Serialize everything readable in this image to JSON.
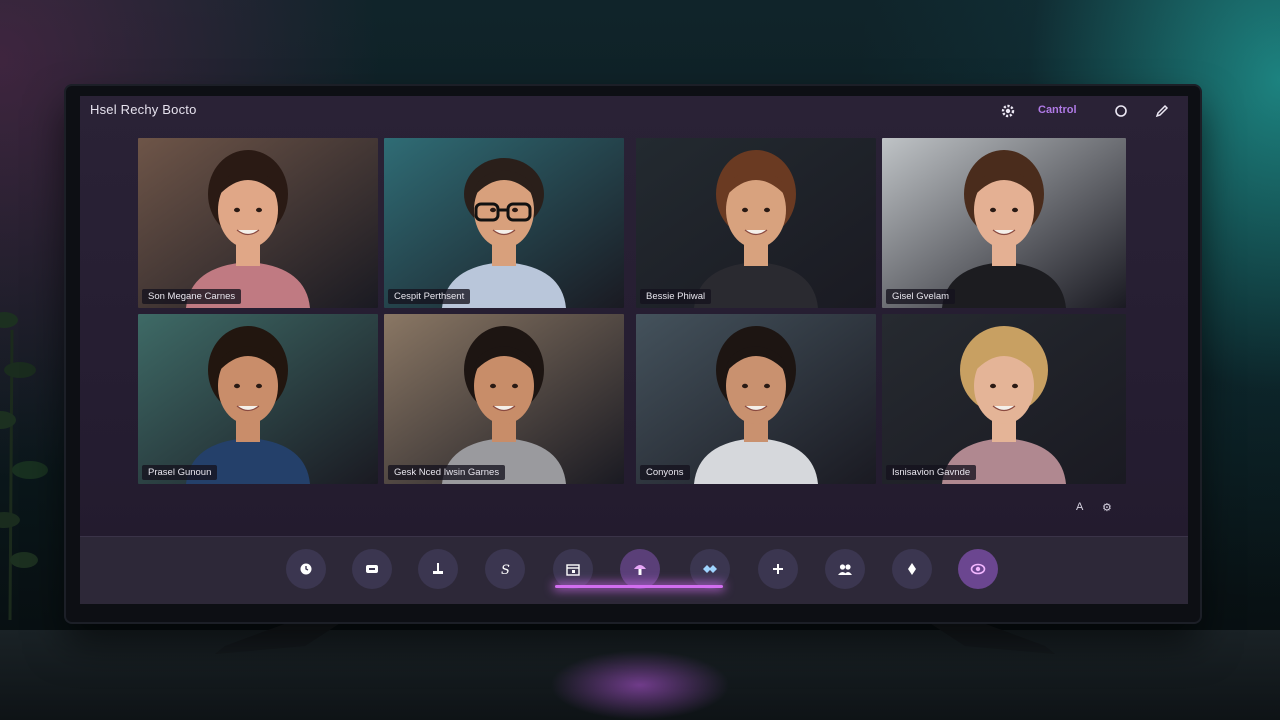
{
  "window": {
    "title": "Hsel Rechy Bocto"
  },
  "header": {
    "control_label": "Cantrol",
    "icons": [
      "settings-icon",
      "circle-icon",
      "pencil-icon"
    ]
  },
  "participants": [
    {
      "name": "Son Megane Carnes",
      "bg": "#6e5548",
      "skin": "#e0a787",
      "hair": "#2a1a14",
      "shirt": "#c07a82"
    },
    {
      "name": "Cespit Perthsent",
      "bg": "#2f6c75",
      "skin": "#d8a07c",
      "hair": "#2a1f1a",
      "shirt": "#b9c6da",
      "glasses": true
    },
    {
      "name": "Bessie Phiwal",
      "bg": "#232a30",
      "skin": "#d8a27e",
      "hair": "#6a3a22",
      "shirt": "#2a2a30"
    },
    {
      "name": "Gisel Gvelam",
      "bg": "#bfc3c6",
      "skin": "#e4b093",
      "hair": "#4a2c1c",
      "shirt": "#1c1c20"
    },
    {
      "name": "Prasel Gunoun",
      "bg": "#3e6a66",
      "skin": "#c98d6a",
      "hair": "#22160f",
      "shirt": "#24406a"
    },
    {
      "name": "Gesk Nced Iwsin Garnes",
      "bg": "#8a7764",
      "skin": "#c88d69",
      "hair": "#1d1512",
      "shirt": "#9a9a9e"
    },
    {
      "name": "Conyons",
      "bg": "#44525c",
      "skin": "#c9916f",
      "hair": "#1d1512",
      "shirt": "#d6d8dc"
    },
    {
      "name": "Isnisavion Gavnde",
      "bg": "#262a30",
      "skin": "#e4b497",
      "hair": "#c8a062",
      "shirt": "#b08890"
    }
  ],
  "side_controls": [
    "A",
    "⚙"
  ],
  "toolbar": {
    "buttons": [
      {
        "icon": "clock-icon"
      },
      {
        "icon": "chat-icon"
      },
      {
        "icon": "stamp-icon"
      },
      {
        "icon": "script-icon",
        "glyph": "S"
      },
      {
        "icon": "calendar-icon"
      },
      {
        "icon": "mushroom-icon"
      },
      {
        "icon": "handshake-icon"
      },
      {
        "icon": "add-icon"
      },
      {
        "icon": "people-icon"
      },
      {
        "icon": "pin-icon"
      },
      {
        "icon": "eye-icon"
      }
    ],
    "active_range": "calendar-to-handshake"
  },
  "colors": {
    "accent": "#d26ef0",
    "control_text": "#b07ae6",
    "screen_bg": "#2a2236"
  }
}
